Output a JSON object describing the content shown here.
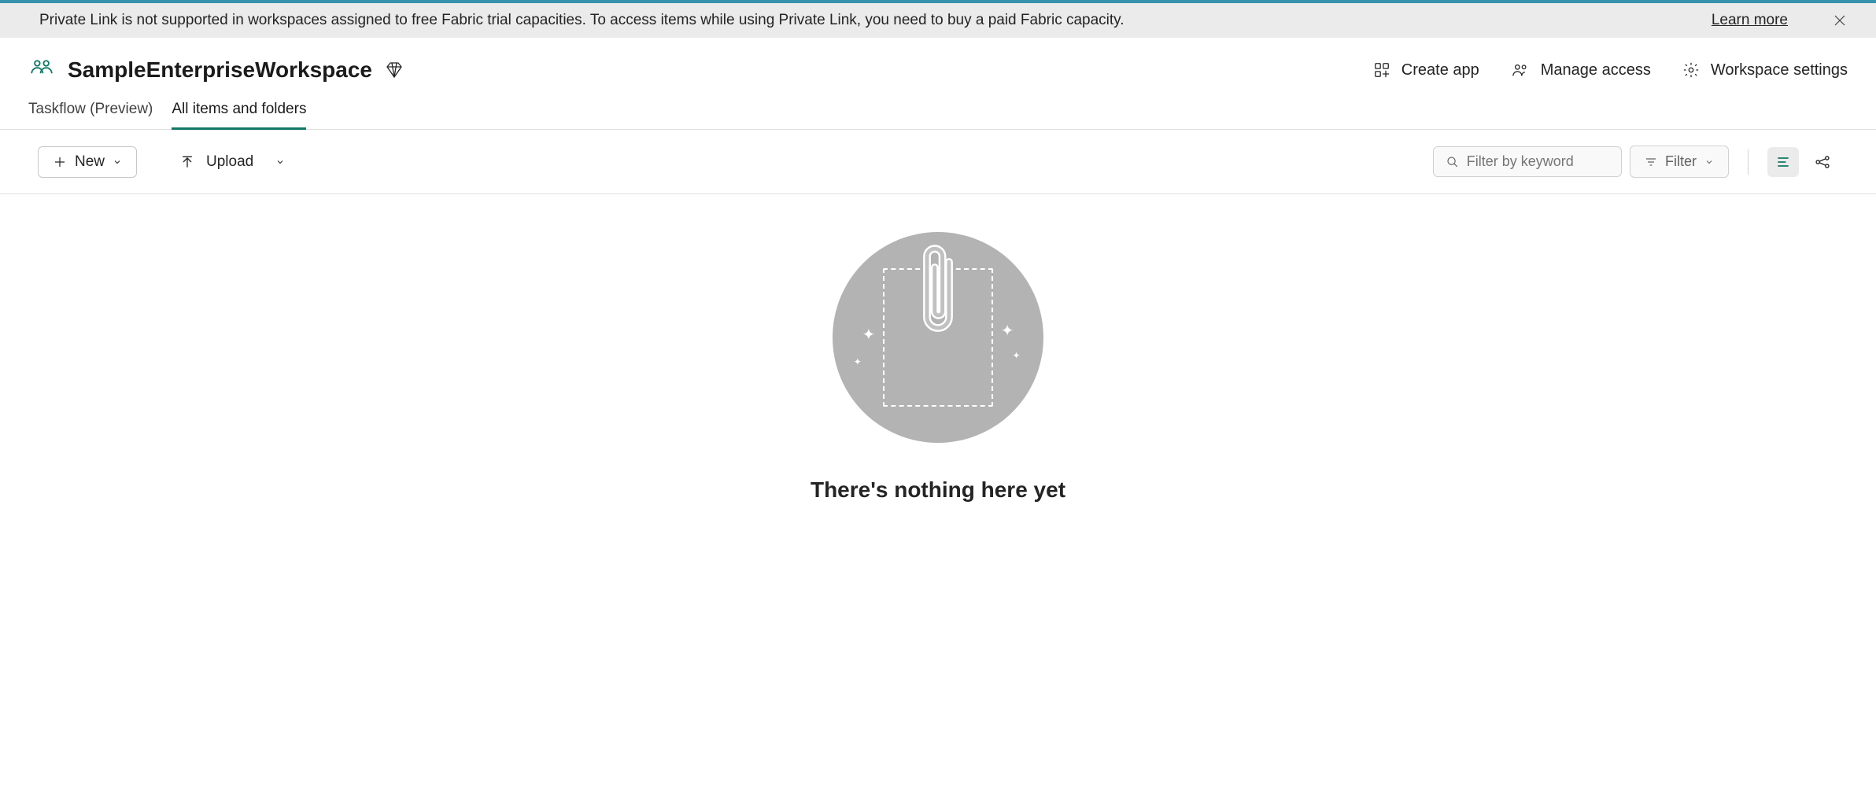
{
  "notification": {
    "message": "Private Link is not supported in workspaces assigned to free Fabric trial capacities. To access items while using Private Link, you need to buy a paid Fabric capacity.",
    "learn_more": "Learn more"
  },
  "workspace": {
    "title": "SampleEnterpriseWorkspace"
  },
  "header_actions": {
    "create_app": "Create app",
    "manage_access": "Manage access",
    "workspace_settings": "Workspace settings"
  },
  "tabs": {
    "taskflow": "Taskflow (Preview)",
    "all_items": "All items and folders"
  },
  "toolbar": {
    "new_label": "New",
    "upload_label": "Upload",
    "filter_placeholder": "Filter by keyword",
    "filter_button": "Filter"
  },
  "empty": {
    "title": "There's nothing here yet"
  }
}
